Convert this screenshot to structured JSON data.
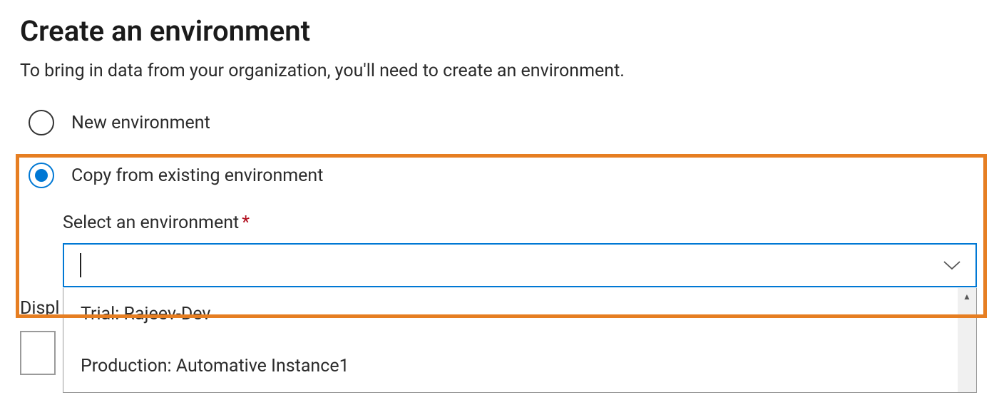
{
  "header": {
    "title": "Create an environment",
    "subtitle": "To bring in data from your organization, you'll need to create an environment."
  },
  "radio": {
    "new_label": "New environment",
    "copy_label": "Copy from existing environment",
    "selected": "copy"
  },
  "select": {
    "label": "Select an environment",
    "required_mark": "*",
    "value": "",
    "options": [
      "Trial: Rajeev-Dev",
      "Production: Automative Instance1"
    ]
  },
  "fragments": {
    "display_label": "Displ"
  }
}
